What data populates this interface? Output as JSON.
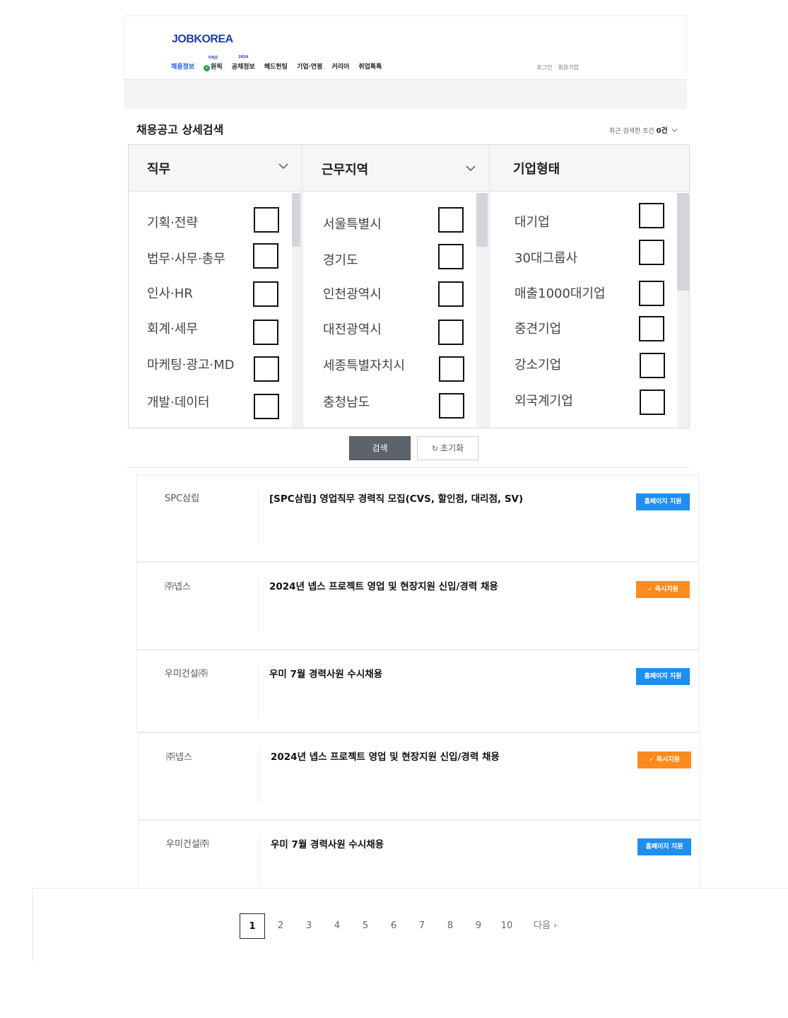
{
  "header": {
    "logo": "JOBKOREA",
    "nav": [
      {
        "label": "채용정보",
        "active": true
      },
      {
        "label": "원픽",
        "super": "이직은",
        "check": true
      },
      {
        "label": "공채정보",
        "super": "2024"
      },
      {
        "label": "헤드헌팅"
      },
      {
        "label": "기업·연봉"
      },
      {
        "label": "커리어"
      },
      {
        "label": "취업톡톡"
      }
    ],
    "login": "로그인",
    "signup": "회원가입"
  },
  "search": {
    "title": "채용공고 상세검색",
    "recent_label": "최근 검색한 조건",
    "recent_count": "0건",
    "columns": [
      {
        "title": "직무",
        "options": [
          "기획·전략",
          "법무·사무·총무",
          "인사·HR",
          "회계·세무",
          "마케팅·광고·MD",
          "개발·데이터"
        ]
      },
      {
        "title": "근무지역",
        "options": [
          "서울특별시",
          "경기도",
          "인천광역시",
          "대전광역시",
          "세종특별자치시",
          "충청남도"
        ]
      },
      {
        "title": "기업형태",
        "options": [
          "대기업",
          "30대그룹사",
          "매출1000대기업",
          "중견기업",
          "강소기업",
          "외국계기업"
        ]
      }
    ],
    "search_button": "검색",
    "reset_button": "초기화"
  },
  "jobs": [
    {
      "company": "SPC삼립",
      "title": "[SPC삼립] 영업직무 경력직 모집(CVS, 할인점, 대리점, SV)",
      "apply": "홈페이지 지원",
      "apply_type": "homepage"
    },
    {
      "company": "㈜넵스",
      "title": "2024년 넵스 프로젝트 영업 및 현장지원 신입/경력 채용",
      "apply": "즉시지원",
      "apply_type": "instant"
    },
    {
      "company": "우미건설㈜",
      "title": "우미 7월 경력사원 수시채용",
      "apply": "홈페이지 지원",
      "apply_type": "homepage"
    },
    {
      "company": "㈜넵스",
      "title": "2024년 넵스 프로젝트 영업 및 현장지원 신입/경력 채용",
      "apply": "즉시지원",
      "apply_type": "instant"
    },
    {
      "company": "우미건설㈜",
      "title": "우미 7월 경력사원 수시채용",
      "apply": "홈페이지 지원",
      "apply_type": "homepage"
    }
  ],
  "pagination": {
    "pages": [
      "1",
      "2",
      "3",
      "4",
      "5",
      "6",
      "7",
      "8",
      "9",
      "10"
    ],
    "current": "1",
    "next": "다음"
  },
  "colors": {
    "logo": "#1b3fa6",
    "nav_active": "#1b55e2",
    "apply_homepage": "#1f8ef1",
    "apply_instant": "#ff8a1e",
    "search_button": "#5d636b"
  },
  "icons": [
    "check-circle-icon",
    "chevron-down-icon",
    "refresh-icon",
    "checkmark-icon",
    "chevron-right-icon"
  ]
}
